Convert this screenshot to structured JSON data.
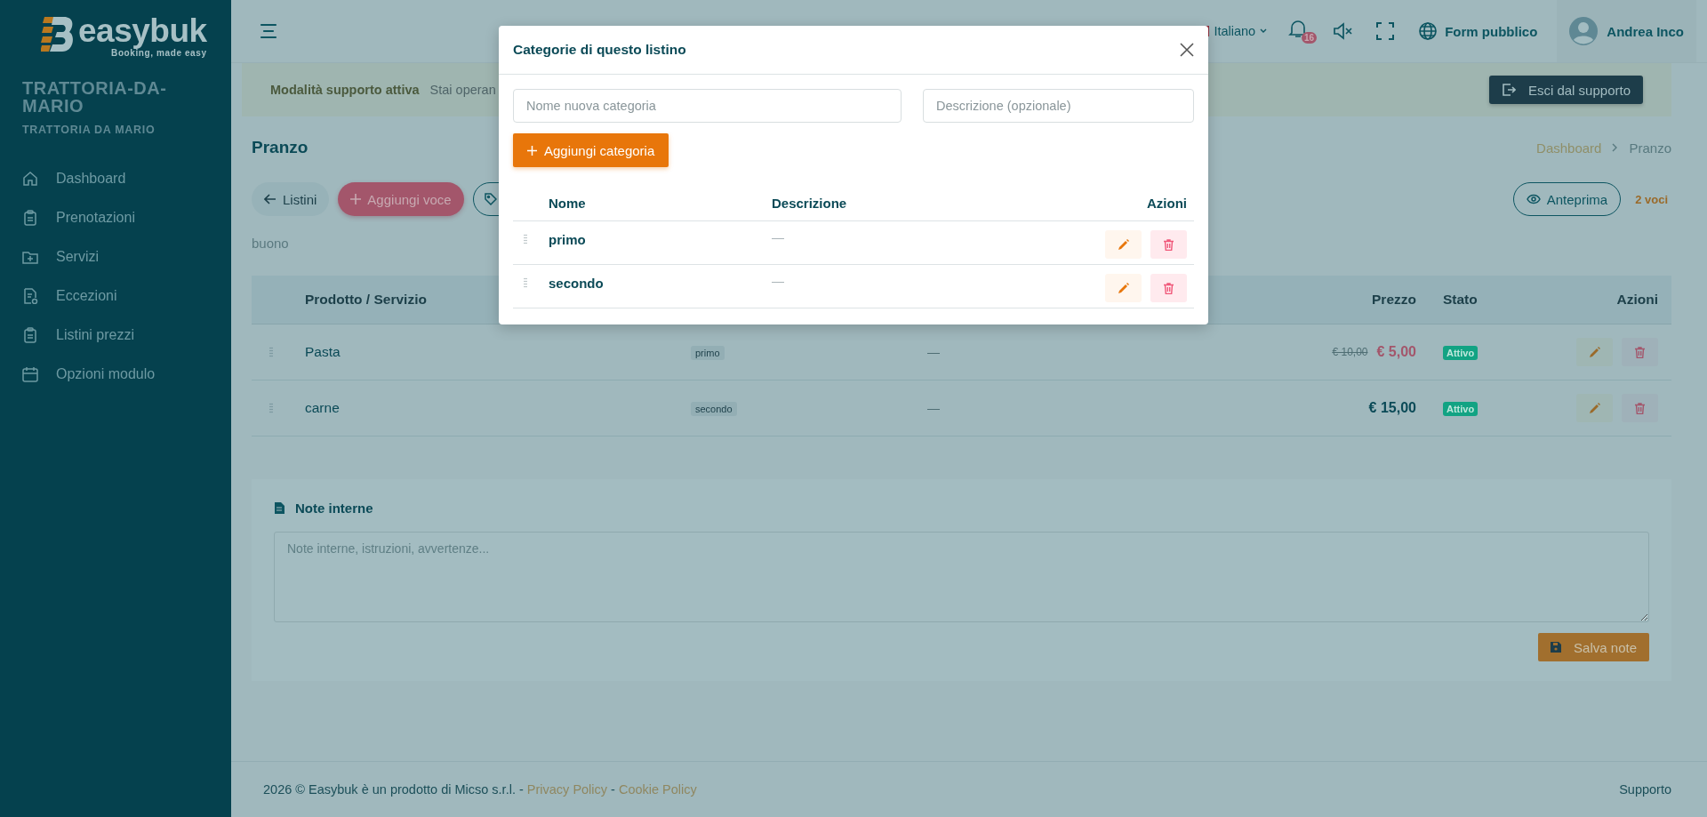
{
  "sidebar": {
    "logo": {
      "wordmark": "easybuk",
      "tagline": "Booking, made easy"
    },
    "org_name": "TRATTORIA-DA-MARIO",
    "org_subtitle": "TRATTORIA DA MARIO",
    "items": [
      {
        "label": "Dashboard"
      },
      {
        "label": "Prenotazioni"
      },
      {
        "label": "Servizi"
      },
      {
        "label": "Eccezioni"
      },
      {
        "label": "Listini prezzi"
      },
      {
        "label": "Opzioni modulo"
      }
    ]
  },
  "header": {
    "language": "Italiano",
    "notifications_count": "16",
    "public_form": "Form pubblico",
    "user": "Andrea Inco"
  },
  "support_banner": {
    "title": "Modalità supporto attiva",
    "text": "Stai operan",
    "exit_button": "Esci dal supporto"
  },
  "page": {
    "title": "Pranzo",
    "breadcrumb": [
      "Dashboard",
      "Pranzo"
    ],
    "back_button": "Listini",
    "add_button": "Aggiungi voce",
    "preview_button": "Anteprima",
    "count": "2 voci",
    "description": "buono"
  },
  "table": {
    "columns": [
      "Prodotto / Servizio",
      "Prezzo",
      "Stato",
      "Azioni"
    ],
    "rows": [
      {
        "name": "Pasta",
        "category": "primo",
        "description": "—",
        "old_price": "€ 10,00",
        "price": "€ 5,00",
        "discounted": true,
        "status": "Attivo"
      },
      {
        "name": "carne",
        "category": "secondo",
        "description": "—",
        "price": "€ 15,00",
        "discounted": false,
        "status": "Attivo"
      }
    ]
  },
  "notes": {
    "title": "Note interne",
    "placeholder": "Note interne, istruzioni, avvertenze...",
    "save_button": "Salva note"
  },
  "footer": {
    "text": "2026 © Easybuk è un prodotto di Micso s.r.l.",
    "separator": "-",
    "links": [
      "Privacy Policy",
      "Cookie Policy"
    ],
    "support": "Supporto"
  },
  "modal": {
    "title": "Categorie di questo listino",
    "name_placeholder": "Nome nuova categoria",
    "description_placeholder": "Descrizione (opzionale)",
    "add_button": "Aggiungi categoria",
    "columns": [
      "Nome",
      "Descrizione",
      "Azioni"
    ],
    "rows": [
      {
        "name": "primo",
        "description": "—"
      },
      {
        "name": "secondo",
        "description": "—"
      }
    ]
  }
}
